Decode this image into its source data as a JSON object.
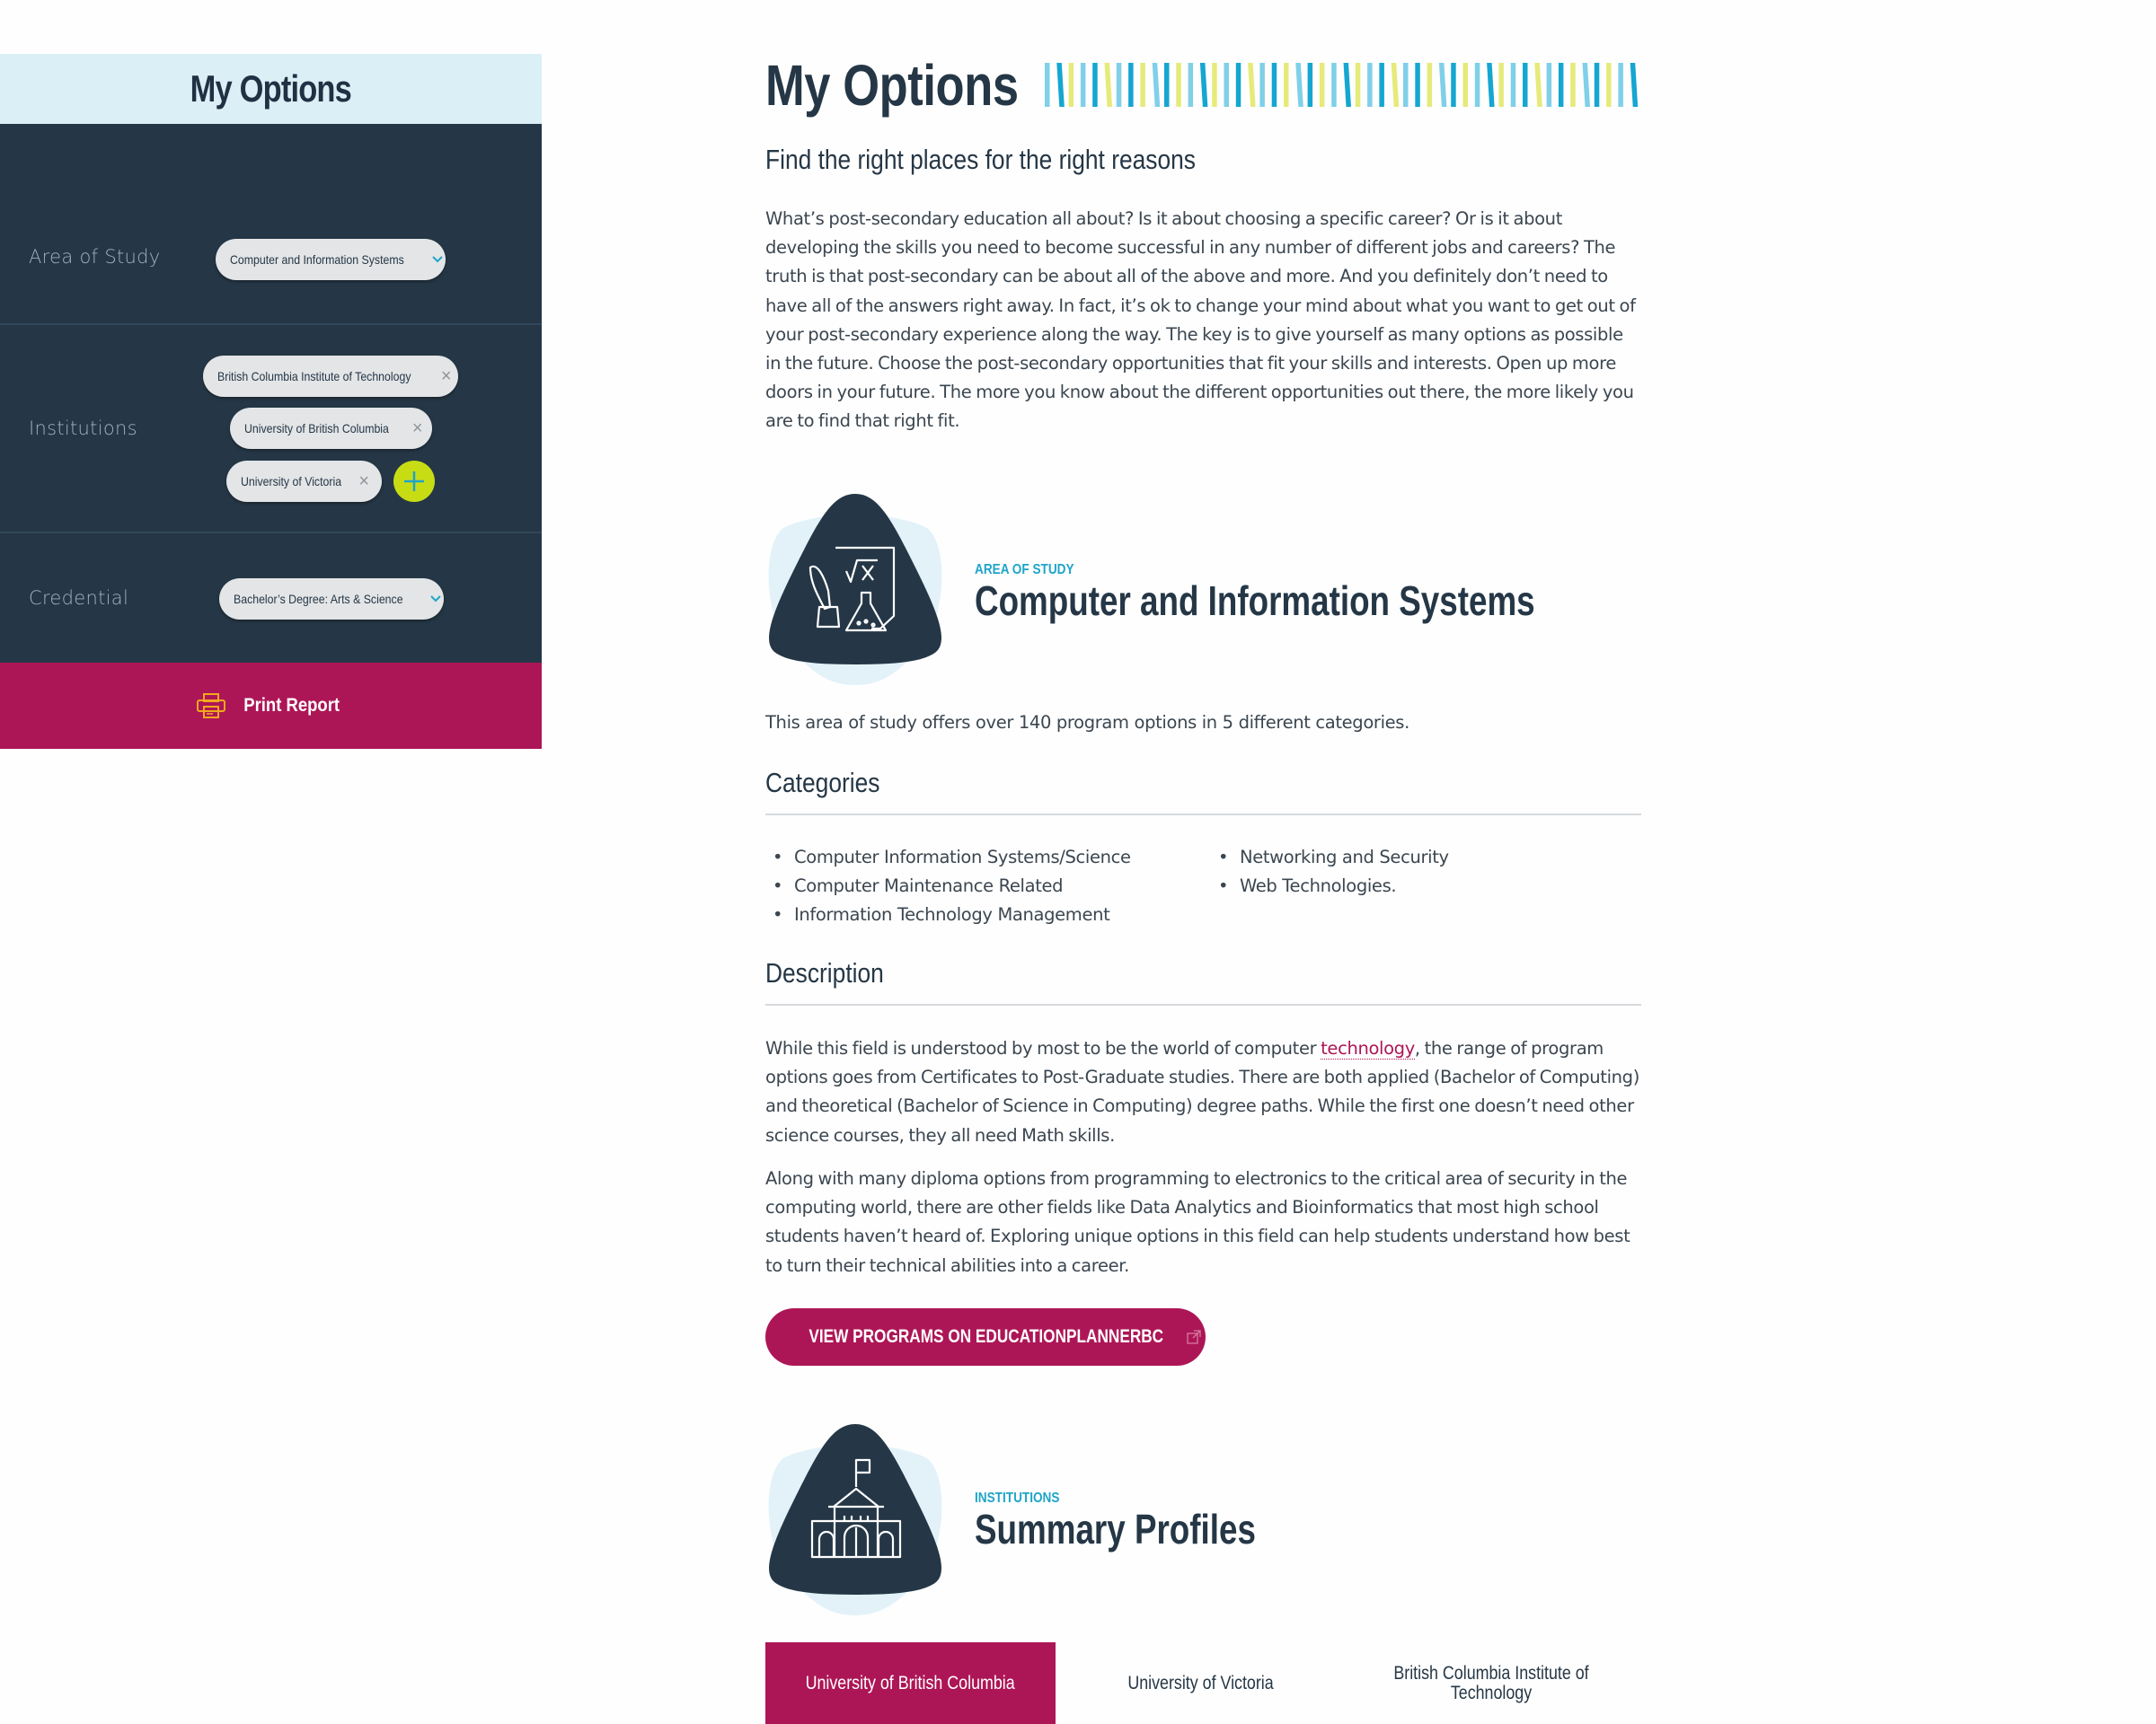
{
  "sidebar": {
    "title": "My Options",
    "area_of_study": {
      "label": "Area of Study",
      "value": "Computer and Information Systems"
    },
    "institutions": {
      "label": "Institutions",
      "items": [
        "British Columbia Institute of Technology",
        "University of British Columbia",
        "University of Victoria"
      ],
      "add_icon": "plus-icon"
    },
    "credential": {
      "label": "Credential",
      "value": "Bachelor’s Degree: Arts & Science"
    },
    "print_label": "Print Report",
    "print_icon": "printer-icon"
  },
  "main": {
    "title": "My Options",
    "stripe_colors": [
      "#7fd0e8",
      "#0e9a47",
      "#ad1656",
      "#e6ea7a",
      "#c8e6f2",
      "#b5941d",
      "#86cfa0",
      "#15a6d1",
      "#c8dc14",
      "#e295b6",
      "#dcc98c"
    ],
    "subtitle": "Find the right places for the right reasons",
    "intro": "What’s post-secondary education all about? Is it about choosing a specific career? Or is it about developing the skills you need to become successful in any number of different jobs and careers? The truth is that post-secondary can be about all of the above and more. And you definitely don’t need to have all of the answers right away. In fact, it’s ok to change your mind about what you want to get out of your post-secondary experience along the way. The key is to give yourself as many options as possible in the future. Choose the post-secondary opportunities that fit your skills and interests. Open up more doors in your future. The more you know about the different opportunities out there, the more likely you are to find that right fit.",
    "area_section": {
      "eyebrow": "AREA OF STUDY",
      "title": "Computer and Information Systems",
      "icon": "science-math-icon",
      "summary": "This area of study offers over 140 program options in 5 different categories.",
      "categories_heading": "Categories",
      "categories": [
        "Computer Information Systems/Science",
        "Computer Maintenance Related",
        "Information Technology Management",
        "Networking and Security",
        "Web Technologies."
      ],
      "description_heading": "Description",
      "description_p1_before": "While this field is understood by most to be the world of computer ",
      "description_p1_link": "technology",
      "description_p1_after": ", the range of program options goes from Certificates to Post-Graduate studies. There are both applied (Bachelor of Computing) and theoretical (Bachelor of Science in Computing) degree paths. While the first one doesn’t need other science courses, they all need Math skills.",
      "description_p2": "Along with many diploma options from programming to electronics to the critical area of security in the computing world, there are other fields like Data Analytics and Bioinformatics that most high school students haven’t heard of. Exploring unique options in this field can help students understand how best to turn their technical abilities into a career.",
      "cta_label": "VIEW PROGRAMS ON EDUCATIONPLANNERBC",
      "cta_icon": "external-link-icon"
    },
    "institutions_section": {
      "eyebrow": "INSTITUTIONS",
      "title": "Summary Profiles",
      "icon": "university-building-icon",
      "tabs": [
        {
          "label": "University of British Columbia",
          "active": true
        },
        {
          "label": "University of Victoria",
          "active": false
        },
        {
          "label": "British Columbia Institute of Technology",
          "active": false
        }
      ]
    }
  },
  "colors": {
    "navy": "#253746",
    "magenta": "#ad1656",
    "cyan": "#1fa4c8",
    "lime": "#c8dc14",
    "light_blue": "#daeff6",
    "print_icon": "#f0a81e"
  }
}
